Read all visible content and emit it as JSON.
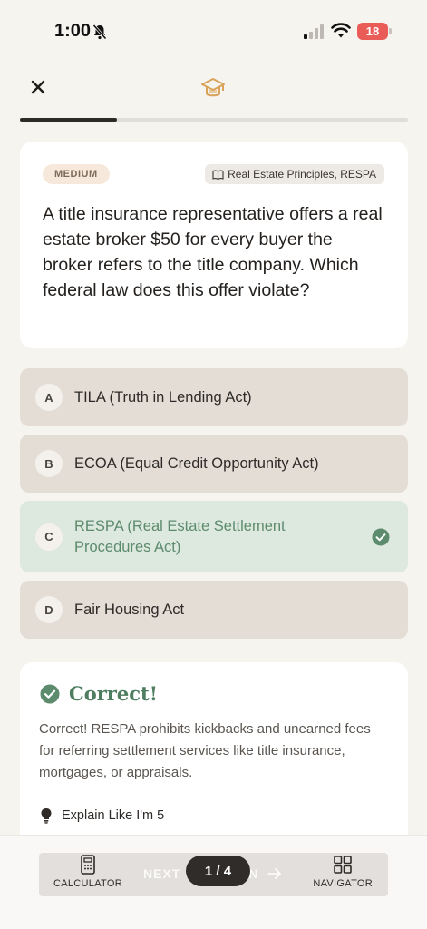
{
  "status_bar": {
    "time": "1:00",
    "battery": "18"
  },
  "progress": {
    "fraction": 0.25
  },
  "question": {
    "difficulty": "MEDIUM",
    "topic": "Real Estate Principles, RESPA",
    "text": "A title insurance representative offers a real estate broker $50 for every buyer the broker refers to the title company. Which federal law does this offer violate?"
  },
  "options": [
    {
      "letter": "A",
      "text": "TILA (Truth in Lending Act)"
    },
    {
      "letter": "B",
      "text": "ECOA (Equal Credit Opportunity Act)"
    },
    {
      "letter": "C",
      "text": "RESPA (Real Estate Settlement Procedures Act)"
    },
    {
      "letter": "D",
      "text": "Fair Housing Act"
    }
  ],
  "feedback": {
    "title": "Correct!",
    "text": "Correct! RESPA prohibits kickbacks and unearned fees for referring settlement services like title insurance, mortgages, or appraisals.",
    "eli5_label": "Explain Like I'm 5"
  },
  "bottom": {
    "calculator_label": "CALCULATOR",
    "navigator_label": "NAVIGATOR",
    "next_label": "NEXT QUESTION",
    "page_indicator": "1 / 4"
  },
  "colors": {
    "correct_green": "#5c8b6d",
    "accent_gold": "#d9a35a",
    "battery_red": "#ea5c58"
  }
}
